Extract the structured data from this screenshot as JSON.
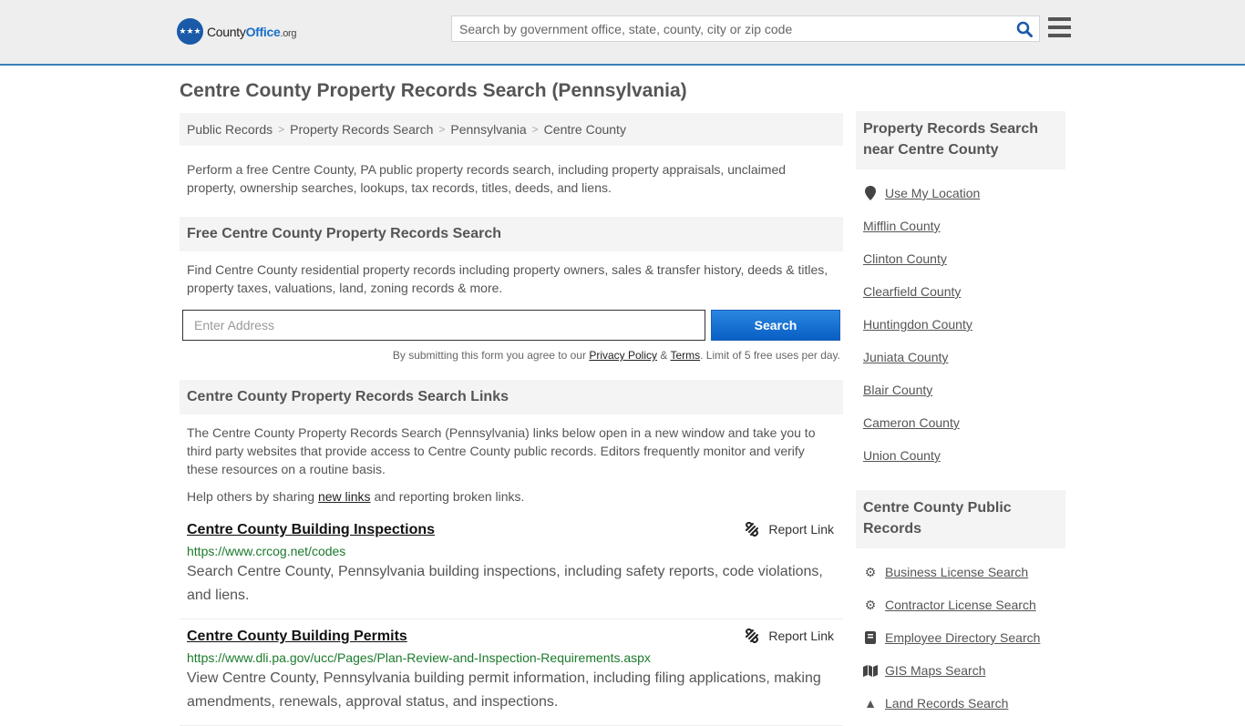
{
  "header": {
    "logo": {
      "brand_a": "County",
      "brand_b": "Office",
      "brand_c": ".org"
    },
    "search_placeholder": "Search by government office, state, county, city or zip code",
    "search_icon": "search-icon",
    "menu_icon": "hamburger-menu-icon"
  },
  "page_title": "Centre County Property Records Search (Pennsylvania)",
  "breadcrumb": [
    "Public Records",
    "Property Records Search",
    "Pennsylvania",
    "Centre County"
  ],
  "intro": "Perform a free Centre County, PA public property records search, including property appraisals, unclaimed property, ownership searches, lookups, tax records, titles, deeds, and liens.",
  "free_search": {
    "heading": "Free Centre County Property Records Search",
    "description": "Find Centre County residential property records including property owners, sales & transfer history, deeds & titles, property taxes, valuations, land, zoning records & more.",
    "input_placeholder": "Enter Address",
    "button_label": "Search",
    "disclaimer_pre": "By submitting this form you agree to our ",
    "privacy_label": "Privacy Policy",
    "amp": " & ",
    "terms_label": "Terms",
    "disclaimer_post": ". Limit of 5 free uses per day."
  },
  "links_section": {
    "heading": "Centre County Property Records Search Links",
    "description": "The Centre County Property Records Search (Pennsylvania) links below open in a new window and take you to third party websites that provide access to Centre County public records. Editors frequently monitor and verify these resources on a routine basis.",
    "help_pre": "Help others by sharing ",
    "help_link": "new links",
    "help_post": " and reporting broken links.",
    "report_label": "Report Link",
    "results": [
      {
        "title": "Centre County Building Inspections",
        "url": "https://www.crcog.net/codes",
        "description": "Search Centre County, Pennsylvania building inspections, including safety reports, code violations, and liens."
      },
      {
        "title": "Centre County Building Permits",
        "url": "https://www.dli.pa.gov/ucc/Pages/Plan-Review-and-Inspection-Requirements.aspx",
        "description": "View Centre County, Pennsylvania building permit information, including filing applications, making amendments, renewals, approval status, and inspections."
      }
    ]
  },
  "sidebar": {
    "nearby_heading": "Property Records Search near Centre County",
    "use_location": "Use My Location",
    "nearby": [
      "Mifflin County",
      "Clinton County",
      "Clearfield County",
      "Huntingdon County",
      "Juniata County",
      "Blair County",
      "Cameron County",
      "Union County"
    ],
    "public_heading": "Centre County Public Records",
    "public_records": [
      {
        "label": "Business License Search",
        "icon": "gears-icon"
      },
      {
        "label": "Contractor License Search",
        "icon": "gear-icon"
      },
      {
        "label": "Employee Directory Search",
        "icon": "book-icon"
      },
      {
        "label": "GIS Maps Search",
        "icon": "map-icon"
      },
      {
        "label": "Land Records Search",
        "icon": "tree-icon"
      }
    ]
  },
  "colors": {
    "accent": "#1a6fc9",
    "header_border": "#3a7fb8",
    "url_green": "#1b7a2c"
  }
}
